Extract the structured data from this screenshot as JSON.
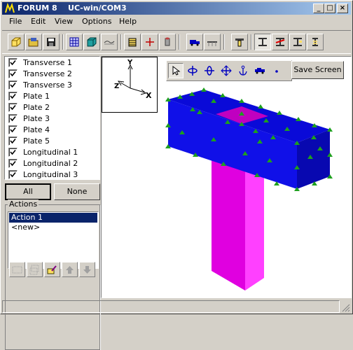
{
  "window": {
    "title": "FORUM 8    UC-win/COM3",
    "controls": {
      "minimize": "_",
      "maximize": "□",
      "close": "×"
    }
  },
  "menu": {
    "items": [
      "File",
      "Edit",
      "View",
      "Options",
      "Help"
    ]
  },
  "toolbar": {
    "buttons": [
      "new-box-icon",
      "open-folder-icon",
      "save-disk-icon",
      "grid-mesh-icon",
      "cube-solid-icon",
      "line-curve-icon",
      "section-icon",
      "cross-point-icon",
      "cylinder-icon",
      "truck-load-icon",
      "bridge-icon",
      "section-flange-icon",
      "ibeam-icon",
      "ibeam-red-icon",
      "ibeam-flag-icon",
      "ibeam-dollar-icon"
    ]
  },
  "layers": {
    "items": [
      {
        "label": "Transverse 1",
        "checked": true
      },
      {
        "label": "Transverse 2",
        "checked": true
      },
      {
        "label": "Transverse 3",
        "checked": true
      },
      {
        "label": "Plate 1",
        "checked": true
      },
      {
        "label": "Plate 2",
        "checked": true
      },
      {
        "label": "Plate 3",
        "checked": true
      },
      {
        "label": "Plate 4",
        "checked": true
      },
      {
        "label": "Plate 5",
        "checked": true
      },
      {
        "label": "Longitudinal 1",
        "checked": true
      },
      {
        "label": "Longitudinal 2",
        "checked": true
      },
      {
        "label": "Longitudinal 3",
        "checked": true
      }
    ],
    "all_label": "All",
    "none_label": "None"
  },
  "actions": {
    "group_label": "Actions",
    "items": [
      {
        "label": "Action 1",
        "selected": true
      },
      {
        "label": "<new>",
        "selected": false
      }
    ]
  },
  "viewport": {
    "axis_labels": {
      "y": "Y",
      "x": "X",
      "z": "Z"
    },
    "nav_tools": [
      "select-arrow-icon",
      "rotate-y-icon",
      "rotate-x-icon",
      "pan-icon",
      "anchor-icon",
      "vehicle-icon",
      "point-icon"
    ],
    "save_label": "Save Screen"
  },
  "colors": {
    "titlebar": "#0a246a",
    "beam": "#1414d4",
    "column": "#ff00ff",
    "nodes": "#1ea01e"
  }
}
